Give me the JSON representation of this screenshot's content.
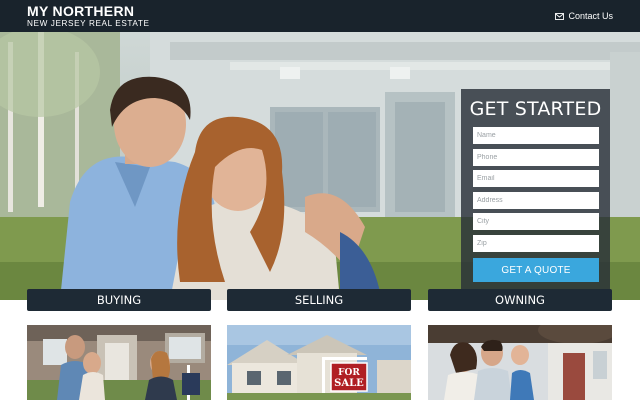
{
  "header": {
    "logo_line1": "MY NORTHERN",
    "logo_line2": "NEW JERSEY REAL ESTATE",
    "contact_label": "Contact Us",
    "contact_icon": "envelope-icon"
  },
  "form": {
    "title": "GET STARTED",
    "fields": {
      "name": "Name",
      "phone": "Phone",
      "email": "Email",
      "address": "Address",
      "city": "City",
      "zip": "Zip"
    },
    "submit_label": "GET A QUOTE"
  },
  "tabs": {
    "buying": "BUYING",
    "selling": "SELLING",
    "owning": "OWNING"
  },
  "thumbnails": {
    "sale_sign_line1": "FOR",
    "sale_sign_line2": "SALE"
  },
  "colors": {
    "header_bg": "#19232c",
    "tab_bg": "#1e2a35",
    "button_bg": "#3aa7dd"
  }
}
